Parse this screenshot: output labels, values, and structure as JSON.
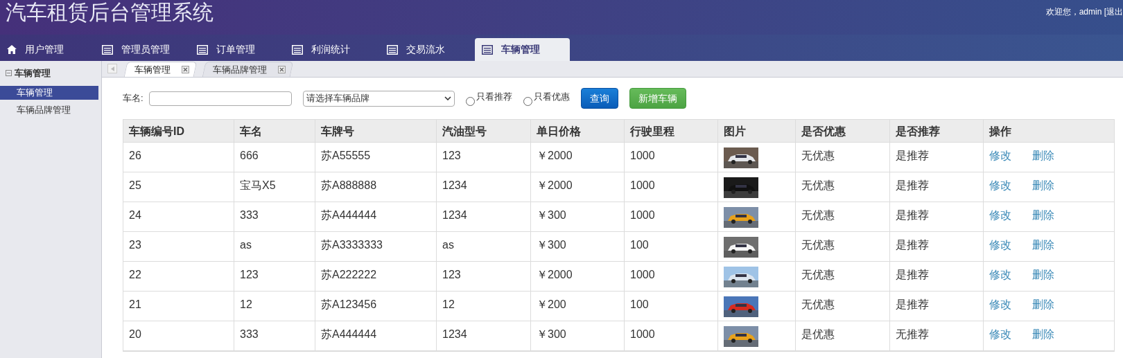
{
  "header": {
    "title": "汽车租赁后台管理系统",
    "welcome": "欢迎您，admin [退出"
  },
  "nav_tabs": [
    {
      "label": "用户管理",
      "kind": "home",
      "selected": false
    },
    {
      "label": "管理员管理",
      "kind": "list",
      "selected": false
    },
    {
      "label": "订单管理",
      "kind": "list",
      "selected": false
    },
    {
      "label": "利润统计",
      "kind": "list",
      "selected": false
    },
    {
      "label": "交易流水",
      "kind": "list",
      "selected": false
    },
    {
      "label": "车辆管理",
      "kind": "list",
      "selected": true
    }
  ],
  "sidebar": {
    "title": "车辆管理",
    "items": [
      {
        "label": "车辆管理",
        "selected": true
      },
      {
        "label": "车辆品牌管理",
        "selected": false
      }
    ]
  },
  "page_tabs": [
    {
      "label": "车辆管理",
      "selected": true
    },
    {
      "label": "车辆品牌管理",
      "selected": false
    }
  ],
  "filters": {
    "name_label": "车名:",
    "brand_placeholder": "请选择车辆品牌",
    "only_recommended": {
      "label": "只看推荐",
      "checked": false
    },
    "only_discount": {
      "label": "只看优惠",
      "checked": false
    },
    "search_button": "查询",
    "add_button": "新增车辆"
  },
  "table": {
    "columns": [
      "车辆编号ID",
      "车名",
      "车牌号",
      "汽油型号",
      "单日价格",
      "行驶里程",
      "图片",
      "是否优惠",
      "是否推荐",
      "操作"
    ],
    "rows": [
      {
        "cells": [
          "26",
          "666",
          "苏A55555",
          "123",
          "￥2000",
          "1000"
        ],
        "photo": {
          "kind": "picture"
        },
        "discount": "无优惠",
        "recommended": "是推荐",
        "actions": [
          "修改",
          "删除"
        ]
      },
      {
        "cells": [
          "25",
          "宝马X5",
          "苏A888888",
          "1234",
          "￥2000",
          "1000"
        ],
        "photo": {
          "kind": "picture"
        },
        "discount": "无优惠",
        "recommended": "是推荐",
        "actions": [
          "修改",
          "删除"
        ]
      },
      {
        "cells": [
          "24",
          "333",
          "苏A444444",
          "1234",
          "￥300",
          "1000"
        ],
        "photo": {
          "kind": "picture"
        },
        "discount": "无优惠",
        "recommended": "是推荐",
        "actions": [
          "修改",
          "删除"
        ]
      },
      {
        "cells": [
          "23",
          "as",
          "苏A3333333",
          "as",
          "￥300",
          "100"
        ],
        "photo": {
          "kind": "picture"
        },
        "discount": "无优惠",
        "recommended": "是推荐",
        "actions": [
          "修改",
          "删除"
        ]
      },
      {
        "cells": [
          "22",
          "123",
          "苏A222222",
          "123",
          "￥2000",
          "1000"
        ],
        "photo": {
          "kind": "picture"
        },
        "discount": "无优惠",
        "recommended": "是推荐",
        "actions": [
          "修改",
          "删除"
        ]
      },
      {
        "cells": [
          "21",
          "12",
          "苏A123456",
          "12",
          "￥200",
          "100"
        ],
        "photo": {
          "kind": "picture"
        },
        "discount": "无优惠",
        "recommended": "是推荐",
        "actions": [
          "修改",
          "删除"
        ]
      },
      {
        "cells": [
          "20",
          "333",
          "苏A444444",
          "1234",
          "￥300",
          "1000"
        ],
        "photo": {
          "kind": "picture"
        },
        "discount": "是优惠",
        "recommended": "无推荐",
        "actions": [
          "修改",
          "删除"
        ]
      }
    ]
  }
}
